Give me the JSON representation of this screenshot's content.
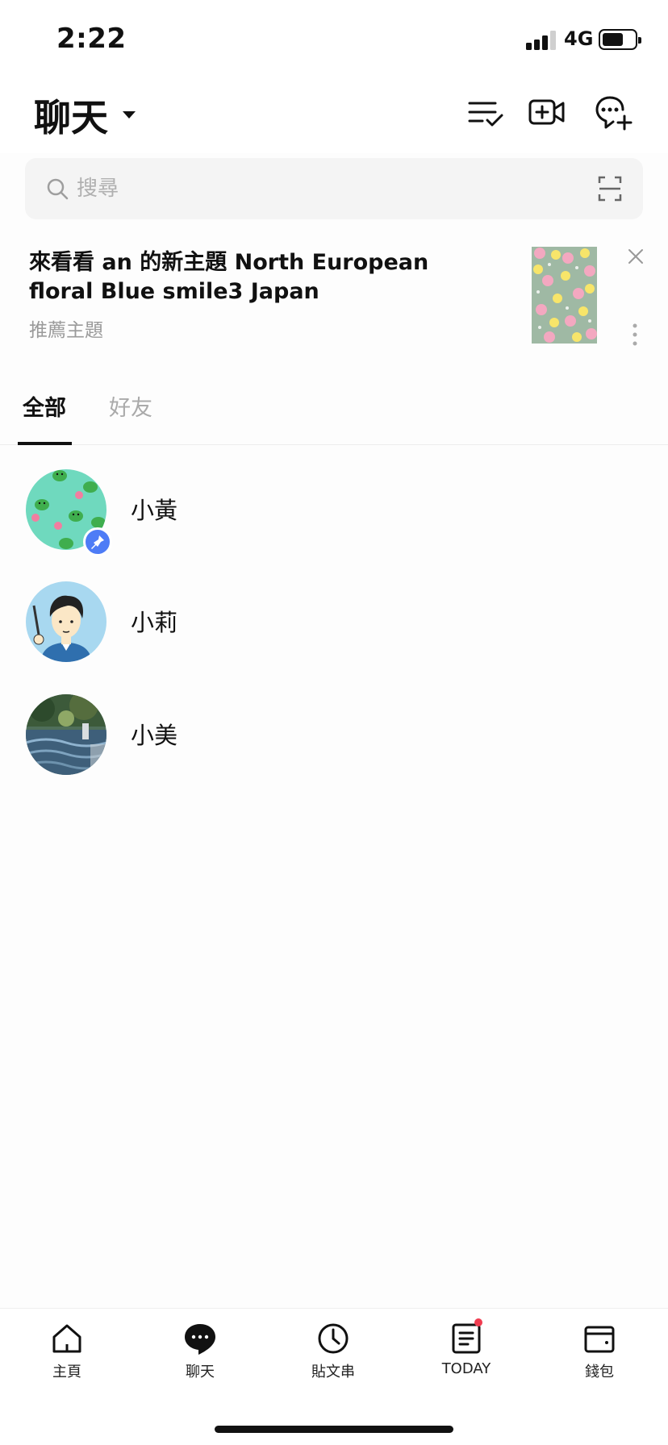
{
  "status_bar": {
    "time": "2:22",
    "network": "4G"
  },
  "header": {
    "title": "聊天"
  },
  "search": {
    "placeholder": "搜尋"
  },
  "banner": {
    "title": "來看看 an 的新主題 North European floral Blue smile3 Japan",
    "subtitle": "推薦主題"
  },
  "tabs": [
    {
      "label": "全部"
    },
    {
      "label": "好友"
    }
  ],
  "chats": [
    {
      "name": "小黃"
    },
    {
      "name": "小莉"
    },
    {
      "name": "小美"
    }
  ],
  "bottom_nav": [
    {
      "label": "主頁",
      "icon": "home-icon"
    },
    {
      "label": "聊天",
      "icon": "chat-bubble-icon"
    },
    {
      "label": "貼文串",
      "icon": "clock-icon"
    },
    {
      "label": "TODAY",
      "icon": "news-icon"
    },
    {
      "label": "錢包",
      "icon": "wallet-icon"
    }
  ],
  "colors": {
    "accent_pin": "#4e7cf6",
    "notification_dot": "#f03c50"
  }
}
